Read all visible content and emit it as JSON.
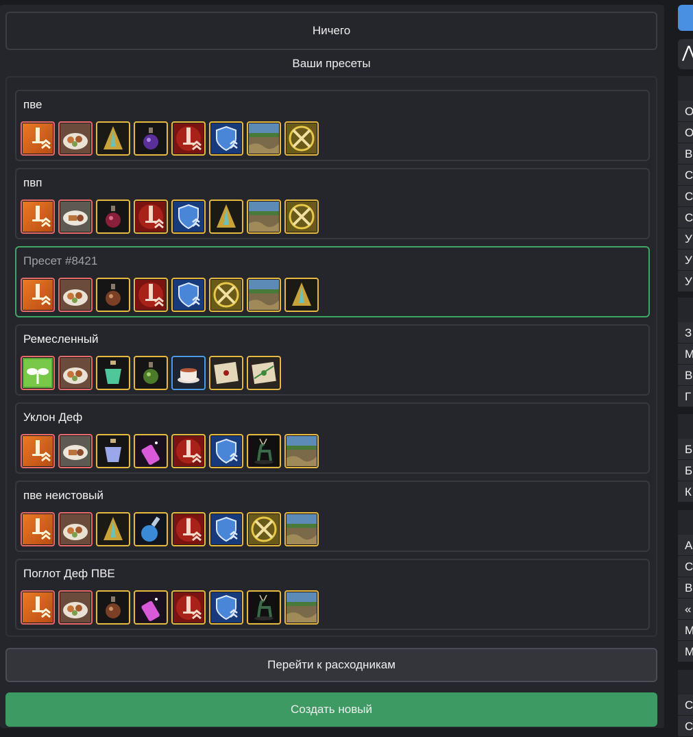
{
  "top_button": "Ничего",
  "presets_title": "Ваши пресеты",
  "presets": [
    {
      "name": "пве",
      "active": false,
      "icons": [
        {
          "name": "attack-buff-icon",
          "border": "red",
          "kind": "atk"
        },
        {
          "name": "food-platter-icon",
          "border": "red",
          "kind": "food"
        },
        {
          "name": "gold-elixir-icon",
          "border": "gold",
          "kind": "goldelx"
        },
        {
          "name": "purple-potion-icon",
          "border": "gold",
          "kind": "purplepot"
        },
        {
          "name": "sword-scroll-icon",
          "border": "gold",
          "kind": "sword"
        },
        {
          "name": "shield-scroll-icon",
          "border": "gold",
          "kind": "shield"
        },
        {
          "name": "landscape-icon",
          "border": "gold",
          "kind": "land"
        },
        {
          "name": "crossed-swords-icon",
          "border": "gold",
          "kind": "cross"
        }
      ]
    },
    {
      "name": "пвп",
      "active": false,
      "icons": [
        {
          "name": "attack-buff-icon",
          "border": "red",
          "kind": "atk"
        },
        {
          "name": "food-dish-icon",
          "border": "red",
          "kind": "food2"
        },
        {
          "name": "red-potion-icon",
          "border": "gold",
          "kind": "redpot"
        },
        {
          "name": "sword-scroll-icon",
          "border": "gold",
          "kind": "sword"
        },
        {
          "name": "shield-scroll-icon",
          "border": "gold",
          "kind": "shield"
        },
        {
          "name": "gold-elixir-icon",
          "border": "gold",
          "kind": "goldelx"
        },
        {
          "name": "landscape-icon",
          "border": "gold",
          "kind": "land"
        },
        {
          "name": "crossed-swords-icon",
          "border": "gold",
          "kind": "cross"
        }
      ]
    },
    {
      "name": "Пресет #8421",
      "active": true,
      "icons": [
        {
          "name": "attack-buff-icon",
          "border": "red",
          "kind": "atk"
        },
        {
          "name": "food-platter-icon",
          "border": "red",
          "kind": "food"
        },
        {
          "name": "brown-potion-icon",
          "border": "gold",
          "kind": "brownpot"
        },
        {
          "name": "sword-scroll-icon",
          "border": "gold",
          "kind": "sword"
        },
        {
          "name": "shield-scroll-icon",
          "border": "gold",
          "kind": "shield"
        },
        {
          "name": "crossed-swords-icon",
          "border": "gold",
          "kind": "cross"
        },
        {
          "name": "landscape-icon",
          "border": "gold",
          "kind": "land"
        },
        {
          "name": "gold-elixir-icon",
          "border": "gold",
          "kind": "goldelx"
        }
      ]
    },
    {
      "name": "Ремесленный",
      "active": false,
      "icons": [
        {
          "name": "sprout-icon",
          "border": "red",
          "kind": "sprout"
        },
        {
          "name": "food-platter-icon",
          "border": "red",
          "kind": "food"
        },
        {
          "name": "green-perfume-icon",
          "border": "gold",
          "kind": "greenperf"
        },
        {
          "name": "green-potion-icon",
          "border": "gold",
          "kind": "greenpot"
        },
        {
          "name": "tea-cup-icon",
          "border": "blue",
          "kind": "tea"
        },
        {
          "name": "sealed-letter-icon",
          "border": "gold",
          "kind": "letter"
        },
        {
          "name": "sealed-letter-green-icon",
          "border": "gold",
          "kind": "letter2"
        }
      ]
    },
    {
      "name": "Уклон Деф",
      "active": false,
      "icons": [
        {
          "name": "attack-buff-icon",
          "border": "red",
          "kind": "atk"
        },
        {
          "name": "food-dish-icon",
          "border": "red",
          "kind": "food2"
        },
        {
          "name": "blue-perfume-icon",
          "border": "gold",
          "kind": "blueperf"
        },
        {
          "name": "pink-vial-icon",
          "border": "gold",
          "kind": "pinkvial"
        },
        {
          "name": "sword-scroll-icon",
          "border": "gold",
          "kind": "sword"
        },
        {
          "name": "shield-scroll-icon",
          "border": "gold",
          "kind": "shield"
        },
        {
          "name": "deer-figurine-icon",
          "border": "gold",
          "kind": "deer"
        },
        {
          "name": "landscape-icon",
          "border": "gold",
          "kind": "land"
        }
      ]
    },
    {
      "name": "пве неистовый",
      "active": false,
      "icons": [
        {
          "name": "attack-buff-icon",
          "border": "red",
          "kind": "atk"
        },
        {
          "name": "food-platter-icon",
          "border": "red",
          "kind": "food"
        },
        {
          "name": "gold-elixir-icon",
          "border": "gold",
          "kind": "goldelx"
        },
        {
          "name": "blue-flask-icon",
          "border": "gold",
          "kind": "blueflask"
        },
        {
          "name": "sword-scroll-icon",
          "border": "gold",
          "kind": "sword"
        },
        {
          "name": "shield-scroll-icon",
          "border": "gold",
          "kind": "shield"
        },
        {
          "name": "crossed-swords-icon",
          "border": "gold",
          "kind": "cross"
        },
        {
          "name": "landscape-icon",
          "border": "gold",
          "kind": "land"
        }
      ]
    },
    {
      "name": "Поглот Деф ПВЕ",
      "active": false,
      "icons": [
        {
          "name": "attack-buff-icon",
          "border": "red",
          "kind": "atk"
        },
        {
          "name": "food-platter-icon",
          "border": "red",
          "kind": "food"
        },
        {
          "name": "brown-potion-icon",
          "border": "gold",
          "kind": "brownpot"
        },
        {
          "name": "pink-vial-icon",
          "border": "gold",
          "kind": "pinkvial"
        },
        {
          "name": "sword-scroll-icon",
          "border": "gold",
          "kind": "sword"
        },
        {
          "name": "shield-scroll-icon",
          "border": "gold",
          "kind": "shield"
        },
        {
          "name": "deer-figurine-icon",
          "border": "gold",
          "kind": "deer"
        },
        {
          "name": "landscape-icon",
          "border": "gold",
          "kind": "land"
        }
      ]
    }
  ],
  "consumables_button": "Перейти к расходникам",
  "create_button": "Создать новый",
  "colors": {
    "active_border": "#3fa765",
    "create_bg": "#3c9a62",
    "accent_blue": "#4a90e2"
  },
  "sidebar": {
    "groups": [
      {
        "rows": [
          "О",
          "О",
          "В",
          "С",
          "С",
          "С",
          "У",
          "У",
          "У"
        ]
      },
      {
        "rows": [
          "З",
          "М",
          "В",
          "Г"
        ]
      },
      {
        "rows": [
          "Б",
          "Б",
          "К"
        ]
      },
      {
        "rows": [
          "А",
          "С",
          "В",
          "«",
          "М",
          "М"
        ]
      },
      {
        "rows": [
          "С",
          "С"
        ]
      }
    ]
  }
}
